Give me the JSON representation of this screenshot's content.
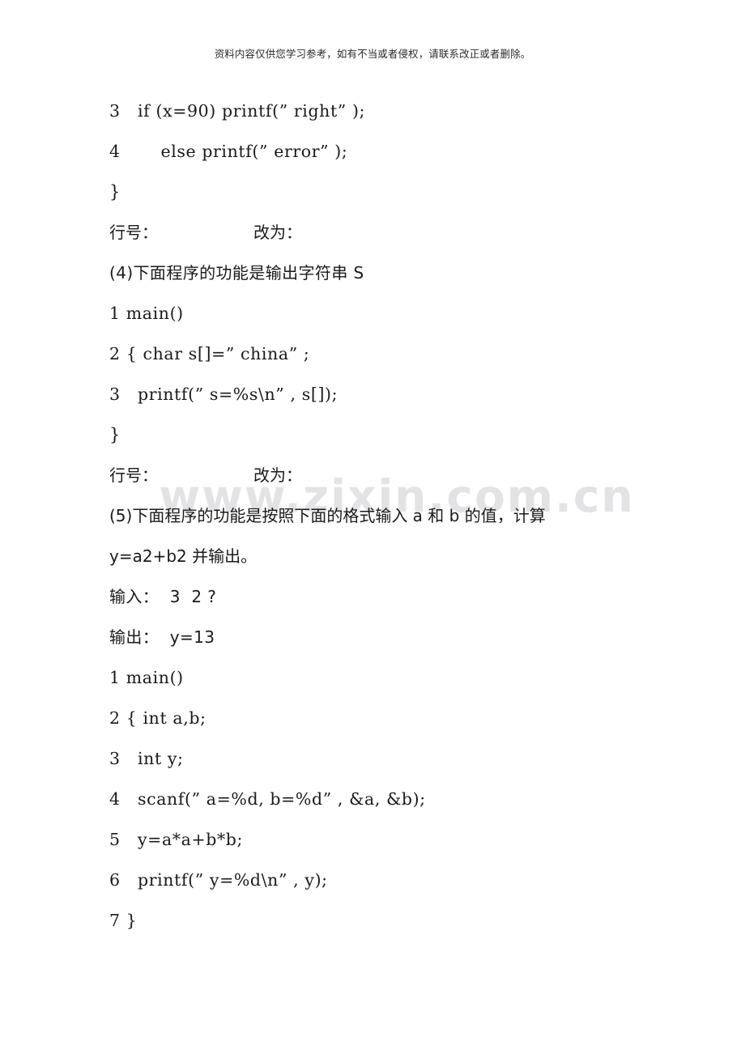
{
  "document": {
    "disclaimer": "资料内容仅供您学习参考，如有不当或者侵权，请联系改正或者删除。",
    "watermark": "www.zixin.com.cn",
    "colors": {
      "text": "#1a1a1a",
      "disclaimer_text": "#2b2b2b",
      "watermark": "#e3e3e6",
      "page_background": "#ffffff"
    },
    "blocks": [
      {
        "id": "q3-code-line-3",
        "kind": "code",
        "text": "3   if (x=90) printf(” right” );"
      },
      {
        "id": "q3-code-line-4",
        "kind": "code",
        "text": "4       else printf(” error” );"
      },
      {
        "id": "q3-code-close-brace",
        "kind": "brace",
        "text": "}"
      },
      {
        "id": "q3-answer-blanks",
        "kind": "answer",
        "label_line_no": "行号：",
        "label_change_to": "改为："
      },
      {
        "id": "q4-prompt",
        "kind": "cjk",
        "text": "(4)下面程序的功能是输出字符串 S"
      },
      {
        "id": "q4-code-line-1",
        "kind": "code",
        "text": "1 main()"
      },
      {
        "id": "q4-code-line-2",
        "kind": "code",
        "text": "2 { char s[]=” china” ;"
      },
      {
        "id": "q4-code-line-3",
        "kind": "code",
        "text": "3   printf(” s=%s\\n” , s[]);"
      },
      {
        "id": "q4-code-close-brace",
        "kind": "brace",
        "text": "}"
      },
      {
        "id": "q4-answer-blanks",
        "kind": "answer",
        "label_line_no": "行号：",
        "label_change_to": "改为："
      },
      {
        "id": "q5-prompt",
        "kind": "para",
        "rows": [
          "(5)下面程序的功能是按照下面的格式输入 a 和 b 的值，计算",
          "y=a2+b2 并输出。"
        ]
      },
      {
        "id": "q5-sample-input",
        "kind": "cjk",
        "text": "输入：  3  2 ?"
      },
      {
        "id": "q5-sample-output",
        "kind": "cjk",
        "text": "输出：  y=13"
      },
      {
        "id": "q5-code-line-1",
        "kind": "code",
        "text": "1 main()"
      },
      {
        "id": "q5-code-line-2",
        "kind": "code",
        "text": "2 { int a,b;"
      },
      {
        "id": "q5-code-line-3",
        "kind": "code",
        "text": "3   int y;"
      },
      {
        "id": "q5-code-line-4",
        "kind": "code",
        "text": "4   scanf(” a=%d, b=%d” , &a, &b);"
      },
      {
        "id": "q5-code-line-5",
        "kind": "code",
        "text": "5   y=a*a+b*b;"
      },
      {
        "id": "q5-code-line-6",
        "kind": "code",
        "text": "6   printf(” y=%d\\n” , y);"
      },
      {
        "id": "q5-code-line-7",
        "kind": "code",
        "text": "7 }"
      }
    ]
  }
}
